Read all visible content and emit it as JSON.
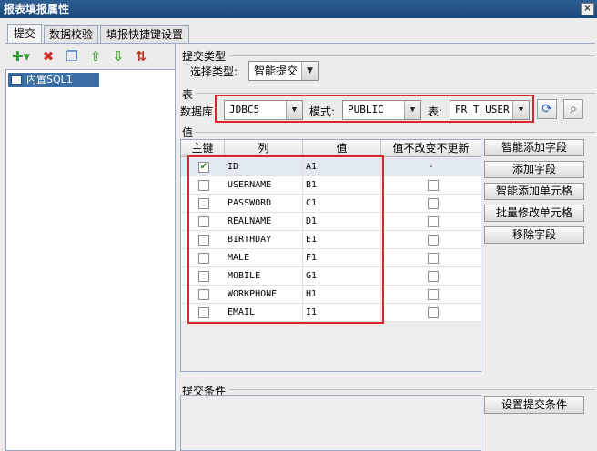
{
  "window": {
    "title": "报表填报属性",
    "close_label": "×"
  },
  "tabs": [
    {
      "label": "提交",
      "active": true
    },
    {
      "label": "数据校验",
      "active": false
    },
    {
      "label": "填报快捷键设置",
      "active": false
    }
  ],
  "toolbar": {
    "add_label": "✚▾",
    "delete_label": "✖",
    "copy_label": "❐",
    "up_label": "⇧",
    "down_label": "⇩",
    "sort_label": "⇅"
  },
  "tree": {
    "items": [
      {
        "label": "内置SQL1",
        "selected": true
      }
    ]
  },
  "submit_type": {
    "section_label": "提交类型",
    "select_label": "选择类型:",
    "value": "智能提交"
  },
  "table_section": {
    "section_label": "表",
    "db_label": "数据库",
    "db_value": "JDBC5",
    "mode_label": "模式:",
    "mode_value": "PUBLIC",
    "table_label": "表:",
    "table_value": "FR_T_USER",
    "refresh_icon": "refresh-icon",
    "preview_icon": "preview-icon"
  },
  "values_section": {
    "section_label": "值",
    "headers": [
      "主键",
      "列",
      "值",
      "值不改变不更新"
    ],
    "rows": [
      {
        "key": true,
        "column": "ID",
        "value": "A1",
        "nochange": "-"
      },
      {
        "key": false,
        "column": "USERNAME",
        "value": "B1",
        "nochange": ""
      },
      {
        "key": false,
        "column": "PASSWORD",
        "value": "C1",
        "nochange": ""
      },
      {
        "key": false,
        "column": "REALNAME",
        "value": "D1",
        "nochange": ""
      },
      {
        "key": false,
        "column": "BIRTHDAY",
        "value": "E1",
        "nochange": ""
      },
      {
        "key": false,
        "column": "MALE",
        "value": "F1",
        "nochange": ""
      },
      {
        "key": false,
        "column": "MOBILE",
        "value": "G1",
        "nochange": ""
      },
      {
        "key": false,
        "column": "WORKPHONE",
        "value": "H1",
        "nochange": ""
      },
      {
        "key": false,
        "column": "EMAIL",
        "value": "I1",
        "nochange": ""
      }
    ],
    "buttons": [
      "智能添加字段",
      "添加字段",
      "智能添加单元格",
      "批量修改单元格",
      "移除字段"
    ]
  },
  "condition_section": {
    "section_label": "提交条件",
    "button_label": "设置提交条件"
  },
  "colors": {
    "titlebar": "#1B4778",
    "selection": "#3A6EA5",
    "highlight_box": "#D9252B"
  }
}
